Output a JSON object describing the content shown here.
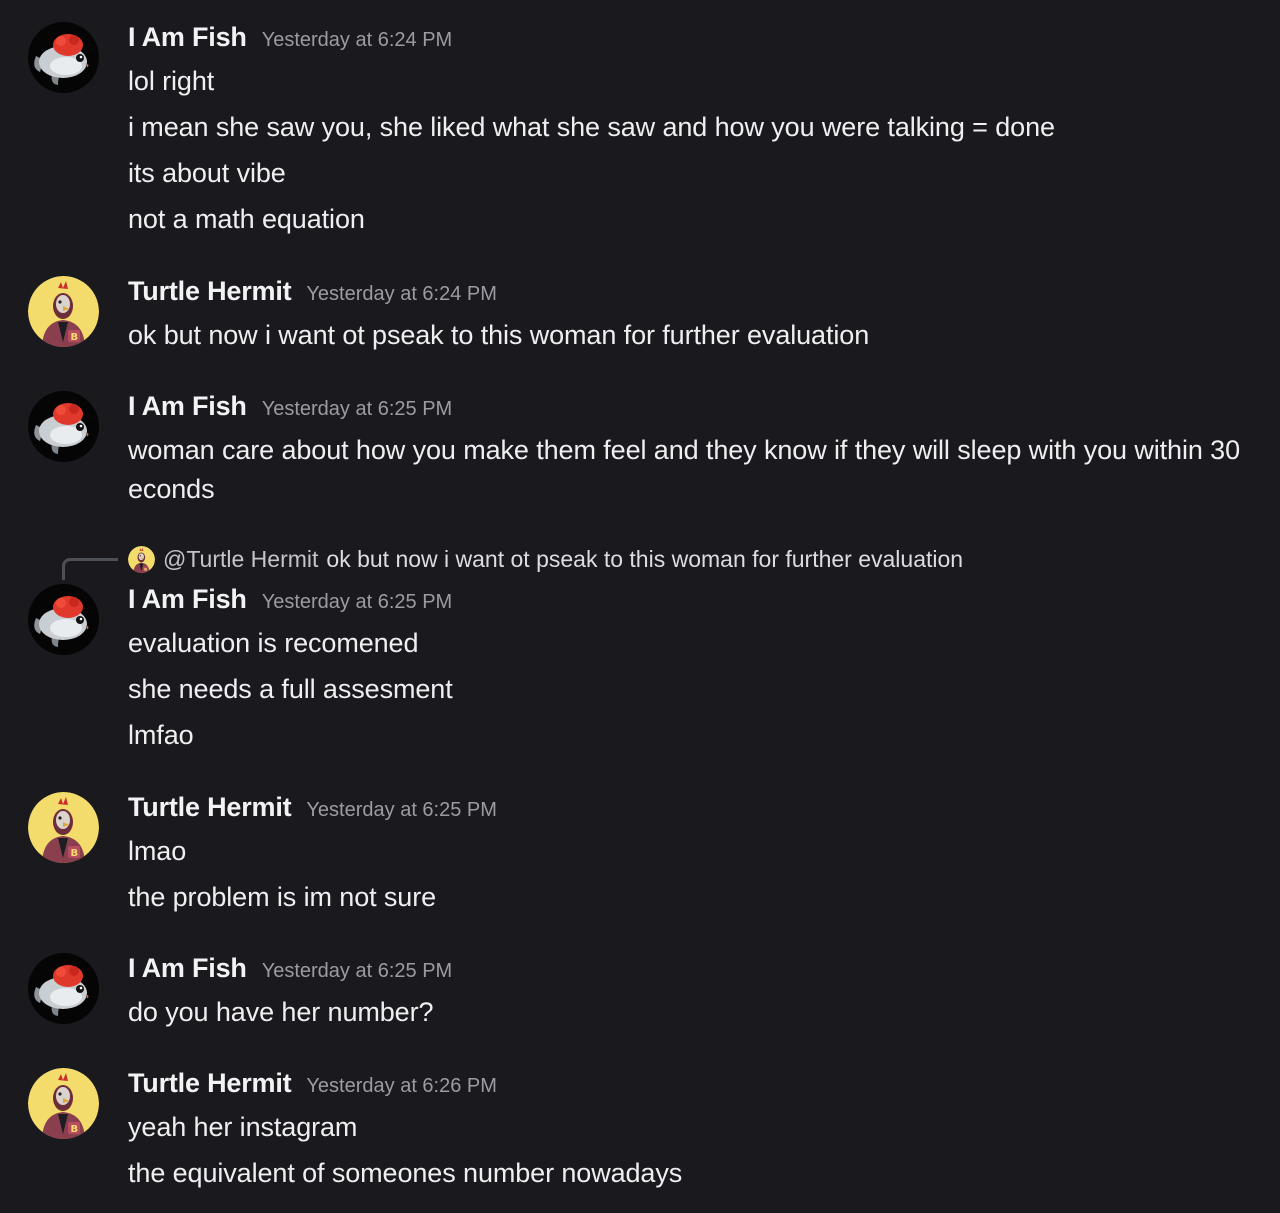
{
  "users": {
    "fish": {
      "name": "I Am Fish",
      "avatar": "goldfish-avatar"
    },
    "hermit": {
      "name": "Turtle Hermit",
      "avatar": "rooster-mask-avatar"
    }
  },
  "messages": [
    {
      "author": "I Am Fish",
      "timestamp": "Yesterday at 6:24 PM",
      "lines": [
        "lol right",
        "i mean she saw you, she liked what she saw and how you were talking = done",
        "its about vibe",
        "not a math equation"
      ]
    },
    {
      "author": "Turtle Hermit",
      "timestamp": "Yesterday at 6:24 PM",
      "lines": [
        "ok but now i want ot pseak to this woman for further evaluation"
      ]
    },
    {
      "author": "I Am Fish",
      "timestamp": "Yesterday at 6:25 PM",
      "lines": [
        "woman care about how you make them feel and they know if they will sleep with you within 30 econds"
      ]
    },
    {
      "author": "I Am Fish",
      "timestamp": "Yesterday at 6:25 PM",
      "reply": {
        "mention": "@Turtle Hermit",
        "text": "ok but now i want ot pseak to this woman for further evaluation"
      },
      "lines": [
        "evaluation is recomened",
        "she needs a full assesment",
        "lmfao"
      ]
    },
    {
      "author": "Turtle Hermit",
      "timestamp": "Yesterday at 6:25 PM",
      "lines": [
        "lmao",
        "the problem is im not sure"
      ]
    },
    {
      "author": "I Am Fish",
      "timestamp": "Yesterday at 6:25 PM",
      "lines": [
        "do you have her number?"
      ]
    },
    {
      "author": "Turtle Hermit",
      "timestamp": "Yesterday at 6:26 PM",
      "lines": [
        "yeah her instagram",
        "the equivalent of someones number nowadays"
      ]
    }
  ]
}
